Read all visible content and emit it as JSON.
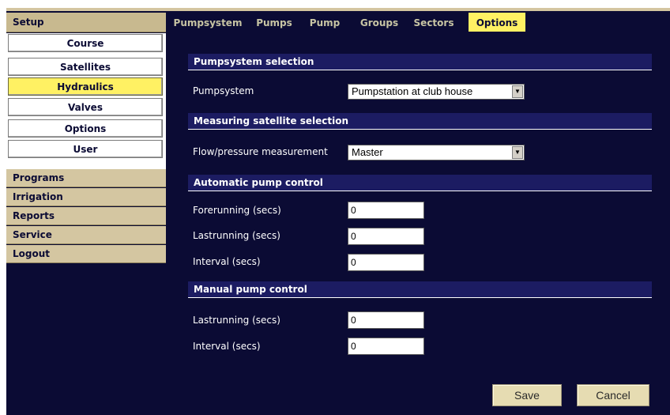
{
  "sidebar": {
    "header": "Setup",
    "sub_items": [
      {
        "label": "Course",
        "active": false
      },
      {
        "label": "Satellites",
        "active": false
      },
      {
        "label": "Hydraulics",
        "active": true
      },
      {
        "label": "Valves",
        "active": false
      },
      {
        "label": "Options",
        "active": false
      },
      {
        "label": "User",
        "active": false
      }
    ],
    "main_items": [
      "Programs",
      "Irrigation",
      "Reports",
      "Service",
      "Logout"
    ]
  },
  "tabs": [
    {
      "label": "Pumpsystem",
      "active": false
    },
    {
      "label": "Pumps",
      "active": false
    },
    {
      "label": "Pump",
      "active": false
    },
    {
      "label": "Groups",
      "active": false
    },
    {
      "label": "Sectors",
      "active": false
    },
    {
      "label": "Options",
      "active": true
    }
  ],
  "sections": {
    "pumpsystem_selection": "Pumpsystem selection",
    "measuring_selection": "Measuring satellite selection",
    "automatic_control": "Automatic pump control",
    "manual_control": "Manual pump control"
  },
  "fields": {
    "pumpsystem": {
      "label": "Pumpsystem",
      "value": "Pumpstation at club house"
    },
    "flow_pressure": {
      "label": "Flow/pressure measurement",
      "value": "Master"
    },
    "auto_forerunning": {
      "label": "Forerunning (secs)",
      "value": "0"
    },
    "auto_lastrunning": {
      "label": "Lastrunning (secs)",
      "value": "0"
    },
    "auto_interval": {
      "label": "Interval (secs)",
      "value": "0"
    },
    "manual_lastrunning": {
      "label": "Lastrunning (secs)",
      "value": "0"
    },
    "manual_interval": {
      "label": "Interval (secs)",
      "value": "0"
    }
  },
  "buttons": {
    "save": "Save",
    "cancel": "Cancel"
  },
  "colors": {
    "background": "#0b0b34",
    "sidebar_tan": "#d4c6a1",
    "active_yellow": "#fff163",
    "section_blue": "#1c1c62",
    "tab_text": "#c8c5a4"
  }
}
